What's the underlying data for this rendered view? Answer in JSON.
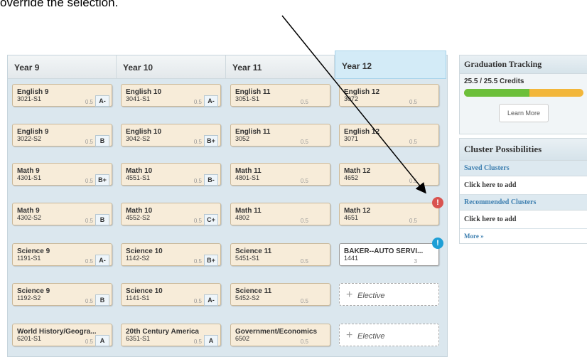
{
  "caption": "override the selection.",
  "top_icons": [
    {
      "icon": "help-icon",
      "color": "#2c74b3"
    },
    {
      "icon": "calendar-icon",
      "color": "#2c74b3"
    },
    {
      "icon": "document-icon",
      "color": "#4a8a3a"
    },
    {
      "icon": "print-icon",
      "color": "#2c74b3"
    },
    {
      "icon": "save-icon",
      "color": "#2c74b3"
    }
  ],
  "columns": [
    {
      "title": "Year 9",
      "cards": [
        {
          "name": "English 9",
          "code": "3021-S1",
          "credit": "0.5",
          "grade": "A-"
        },
        {
          "name": "English 9",
          "code": "3022-S2",
          "credit": "0.5",
          "grade": "B"
        },
        {
          "name": "Math 9",
          "code": "4301-S1",
          "credit": "0.5",
          "grade": "B+"
        },
        {
          "name": "Math 9",
          "code": "4302-S2",
          "credit": "0.5",
          "grade": "B"
        },
        {
          "name": "Science 9",
          "code": "1191-S1",
          "credit": "0.5",
          "grade": "A-"
        },
        {
          "name": "Science 9",
          "code": "1192-S2",
          "credit": "0.5",
          "grade": "B"
        },
        {
          "name": "World History/Geogra...",
          "code": "6201-S1",
          "credit": "0.5",
          "grade": "A"
        }
      ]
    },
    {
      "title": "Year 10",
      "cards": [
        {
          "name": "English 10",
          "code": "3041-S1",
          "credit": "0.5",
          "grade": "A-"
        },
        {
          "name": "English 10",
          "code": "3042-S2",
          "credit": "0.5",
          "grade": "B+"
        },
        {
          "name": "Math 10",
          "code": "4551-S1",
          "credit": "0.5",
          "grade": "B-"
        },
        {
          "name": "Math 10",
          "code": "4552-S2",
          "credit": "0.5",
          "grade": "C+"
        },
        {
          "name": "Science 10",
          "code": "1142-S2",
          "credit": "0.5",
          "grade": "B+"
        },
        {
          "name": "Science 10",
          "code": "1141-S1",
          "credit": "0.5",
          "grade": "A-"
        },
        {
          "name": "20th Century America",
          "code": "6351-S1",
          "credit": "0.5",
          "grade": "A"
        }
      ]
    },
    {
      "title": "Year 11",
      "cards": [
        {
          "name": "English 11",
          "code": "3051-S1",
          "credit": "0.5"
        },
        {
          "name": "English 11",
          "code": "3052",
          "credit": "0.5"
        },
        {
          "name": "Math 11",
          "code": "4801-S1",
          "credit": "0.5"
        },
        {
          "name": "Math 11",
          "code": "4802",
          "credit": "0.5"
        },
        {
          "name": "Science 11",
          "code": "5451-S1",
          "credit": "0.5"
        },
        {
          "name": "Science 11",
          "code": "5452-S2",
          "credit": "0.5"
        },
        {
          "name": "Government/Economics",
          "code": "6502",
          "credit": "0.5"
        }
      ]
    },
    {
      "title": "Year 12",
      "cards": [
        {
          "name": "English 12",
          "code": "3072",
          "credit": "0.5"
        },
        {
          "name": "English 12",
          "code": "3071",
          "credit": "0.5"
        },
        {
          "name": "Math 12",
          "code": "4652",
          "credit": "0.5"
        },
        {
          "name": "Math 12",
          "code": "4651",
          "credit": "0.5",
          "alert": "!",
          "alert_color": "#d9534f"
        },
        {
          "name": "BAKER--AUTO SERVI...",
          "code": "1441",
          "credit": "3",
          "alert": "!",
          "alert_color": "#1e9fd6",
          "style": "white"
        },
        {
          "elective": "Elective",
          "plus": "+"
        },
        {
          "elective": "Elective",
          "plus": "+"
        }
      ]
    }
  ],
  "graduation": {
    "title": "Graduation Tracking",
    "credits": "25.5 / 25.5 Credits",
    "green_fraction": 0.55,
    "colors": {
      "green": "#6cbf3a",
      "yellow": "#f2b63a"
    },
    "learn_more": "Learn More"
  },
  "cluster": {
    "title": "Cluster Possibilities",
    "saved": "Saved Clusters",
    "saved_add": "Click here to add",
    "recommended": "Recommended Clusters",
    "recommended_add": "Click here to add",
    "more": "More »"
  }
}
